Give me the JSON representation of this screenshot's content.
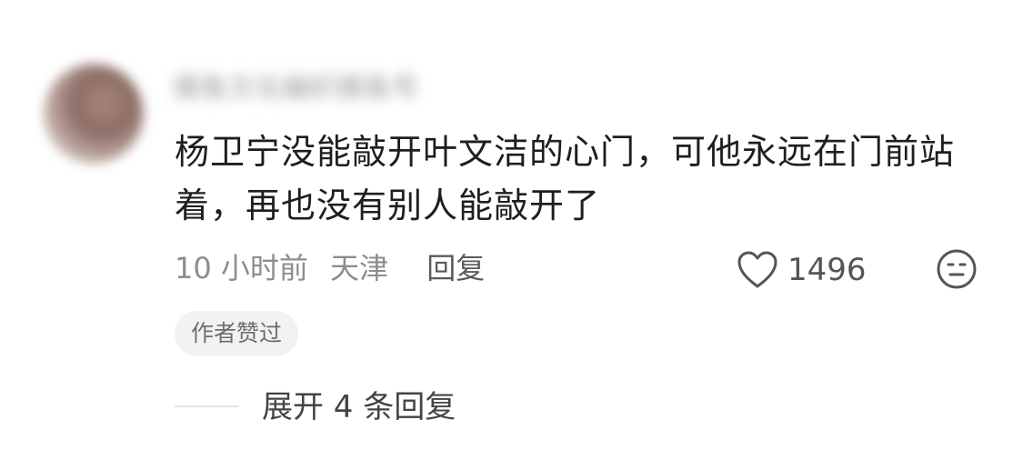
{
  "comment": {
    "username": "摸鱼文化编织摸鱼号",
    "text": "杨卫宁没能敲开叶文洁的心门，可他永远在门前站着，再也没有别人能敲开了",
    "time": "10 小时前",
    "location": "天津",
    "reply_label": "回复",
    "like_count": "1496",
    "author_badge": "作者赞过",
    "expand_replies_label": "展开 4 条回复"
  },
  "icons": {
    "like": "heart-icon",
    "dislike": "neutral-face-icon"
  },
  "colors": {
    "text_primary": "#1e1e1e",
    "text_secondary": "#8d8d8d",
    "badge_bg": "#f2f2f2"
  }
}
